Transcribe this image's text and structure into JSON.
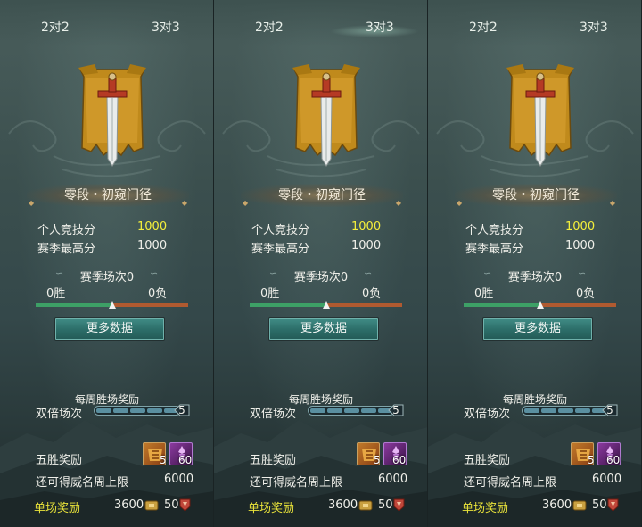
{
  "panels": [
    {
      "tabs": {
        "left": "2对2",
        "right": "3对3",
        "active": "none"
      },
      "rank_name": "零段・初窥门径",
      "stats": {
        "personal_label": "个人竞技分",
        "personal_value": "1000",
        "season_high_label": "赛季最高分",
        "season_high_value": "1000"
      },
      "season": {
        "title": "赛季场次0",
        "wins": "0胜",
        "losses": "0负",
        "marker_fraction": 0.5
      },
      "more_button": "更多数据",
      "weekly": {
        "title": "每周胜场奖励",
        "double_label": "双倍场次",
        "double_count": "5",
        "five_win_label": "五胜奖励",
        "item_a_count": "5",
        "item_b_count": "60",
        "cap_label": "还可得威名周上限",
        "cap_value": "6000",
        "single_label": "单场奖励",
        "single_value_a": "3600",
        "single_value_b": "50"
      }
    },
    {
      "tabs": {
        "left": "2对2",
        "right": "3对3",
        "active": "right"
      },
      "rank_name": "零段・初窥门径",
      "stats": {
        "personal_label": "个人竞技分",
        "personal_value": "1000",
        "season_high_label": "赛季最高分",
        "season_high_value": "1000"
      },
      "season": {
        "title": "赛季场次0",
        "wins": "0胜",
        "losses": "0负",
        "marker_fraction": 0.5
      },
      "more_button": "更多数据",
      "weekly": {
        "title": "每周胜场奖励",
        "double_label": "双倍场次",
        "double_count": "5",
        "five_win_label": "五胜奖励",
        "item_a_count": "5",
        "item_b_count": "60",
        "cap_label": "还可得威名周上限",
        "cap_value": "6000",
        "single_label": "单场奖励",
        "single_value_a": "3600",
        "single_value_b": "50"
      }
    },
    {
      "tabs": {
        "left": "2对2",
        "right": "3对3",
        "active": "none"
      },
      "rank_name": "零段・初窥门径",
      "stats": {
        "personal_label": "个人竞技分",
        "personal_value": "1000",
        "season_high_label": "赛季最高分",
        "season_high_value": "1000"
      },
      "season": {
        "title": "赛季场次0",
        "wins": "0胜",
        "losses": "0负",
        "marker_fraction": 0.5
      },
      "more_button": "更多数据",
      "weekly": {
        "title": "每周胜场奖励",
        "double_label": "双倍场次",
        "double_count": "5",
        "five_win_label": "五胜奖励",
        "item_a_count": "5",
        "item_b_count": "60",
        "cap_label": "还可得威名周上限",
        "cap_value": "6000",
        "single_label": "单场奖励",
        "single_value_a": "3600",
        "single_value_b": "50"
      }
    }
  ],
  "colors": {
    "highlight_score": "#f4ef3b",
    "single_label": "#e9e33a",
    "win_bar": "#3da066",
    "loss_bar": "#b05a30",
    "button": "#2d6f6a"
  },
  "icons": [
    "sword-banner-emblem",
    "coin-icon",
    "badge-icon",
    "reward-item-orange",
    "reward-item-purple"
  ]
}
